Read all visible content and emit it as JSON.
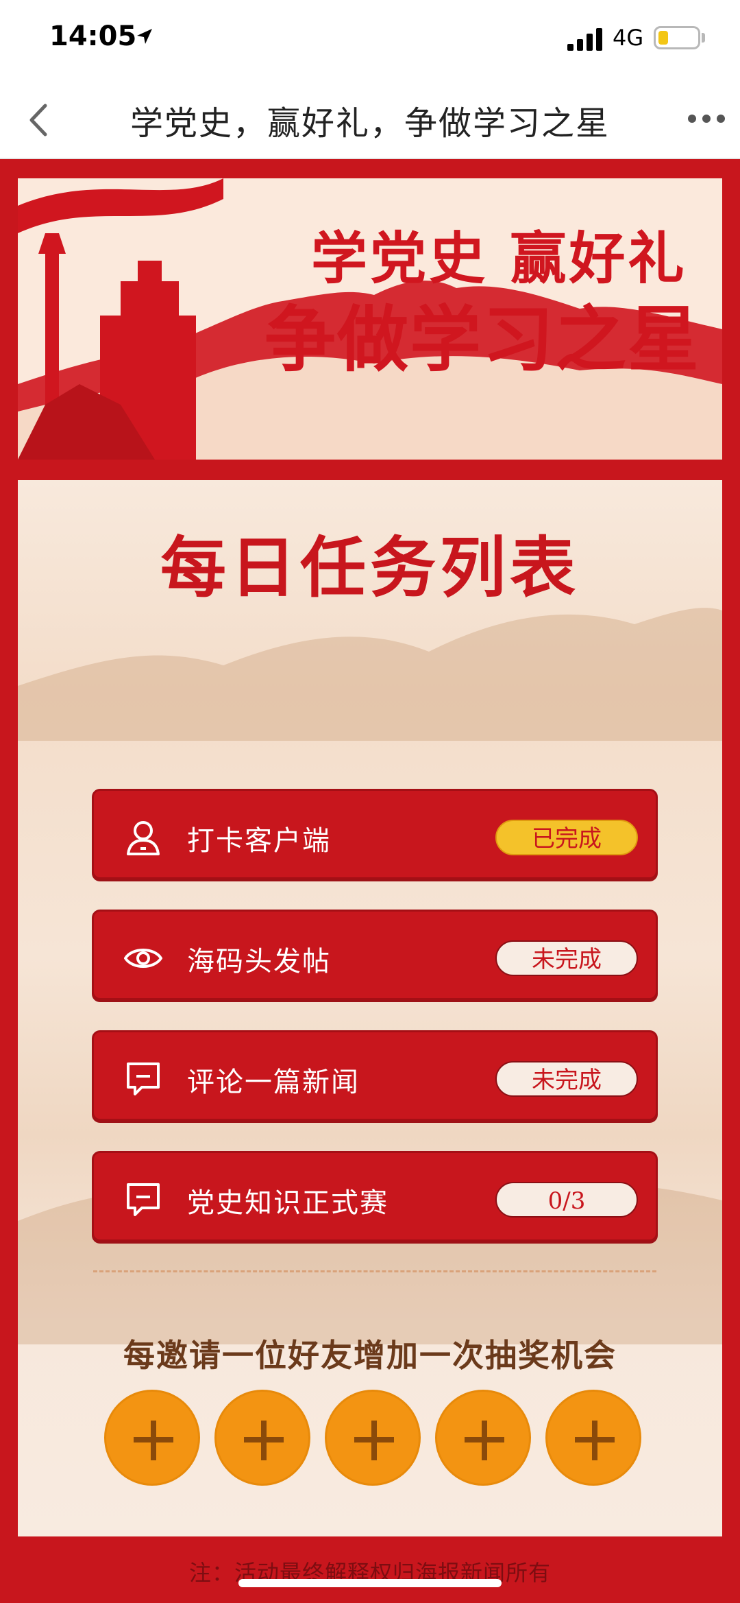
{
  "status_bar": {
    "time": "14:05",
    "network": "4G"
  },
  "nav": {
    "title": "学党史，赢好礼，争做学习之星"
  },
  "banner": {
    "line1": "学党史 赢好礼",
    "line2": "争做学习之星"
  },
  "panel": {
    "title": "每日任务列表",
    "tasks": [
      {
        "label": "打卡客户端",
        "status": "已完成",
        "icon": "user-icon"
      },
      {
        "label": "海码头发帖",
        "status": "未完成",
        "icon": "eye-icon"
      },
      {
        "label": "评论一篇新闻",
        "status": "未完成",
        "icon": "comment-icon"
      },
      {
        "label": "党史知识正式赛",
        "status": "0/3",
        "icon": "comment-icon"
      }
    ],
    "invite_text": "每邀请一位好友增加一次抽奖机会",
    "invite_slots": 5
  },
  "footnote": "注：活动最终解释权归海报新闻所有",
  "colors": {
    "primary_red": "#c8161d",
    "done_yellow": "#f4c22a",
    "invite_orange": "#f39412"
  }
}
